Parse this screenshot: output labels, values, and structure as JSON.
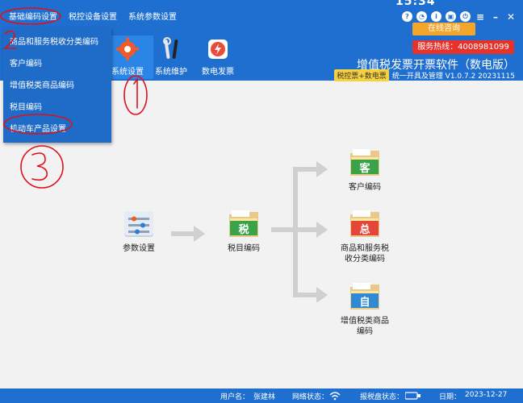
{
  "menubar": {
    "items": [
      "基础编码设置",
      "税控设备设置",
      "系统参数设置"
    ],
    "clock": "15:34",
    "controls": [
      "help-icon",
      "headset-icon",
      "info-icon",
      "lock-icon",
      "power-icon",
      "menu-icon",
      "minimize-icon",
      "close-icon"
    ]
  },
  "toolbar": {
    "tools": [
      {
        "label": "系统设置",
        "icon": "gear-icon"
      },
      {
        "label": "系统维护",
        "icon": "tools-icon"
      },
      {
        "label": "数电发票",
        "icon": "invoice-icon"
      }
    ],
    "consult": "在线咨询",
    "hotline": "服务热线：4008981099",
    "brand_title": "增值税发票开票软件（数电版）",
    "brand_badge": "税控票+数电票",
    "brand_version": "统一开具及管理 V1.0.7.2 20231115"
  },
  "dropdown": {
    "items": [
      "商品和服务税收分类编码",
      "客户编码",
      "增值税类商品编码",
      "税目编码",
      "机动车产品设置"
    ]
  },
  "flow": {
    "params": "参数设置",
    "tax_item": "税目编码",
    "tax_char": "税",
    "customer": "客户编码",
    "customer_char": "客",
    "goods_line1": "商品和服务税",
    "goods_line2": "收分类编码",
    "goods_char": "总",
    "vat_line1": "增值税类商品",
    "vat_line2": "编码",
    "vat_char": "自"
  },
  "status": {
    "user_label": "用户名：",
    "user": "张建林",
    "net_label": "网络状态：",
    "disk_label": "报税盘状态：",
    "date_label": "日期：",
    "date": "2023-12-27"
  },
  "colors": {
    "bar_blue": "#1f6fd0",
    "annotation_red": "#e0101a",
    "hotline_red": "#e7322a",
    "consult_orange": "#f3a52c"
  }
}
